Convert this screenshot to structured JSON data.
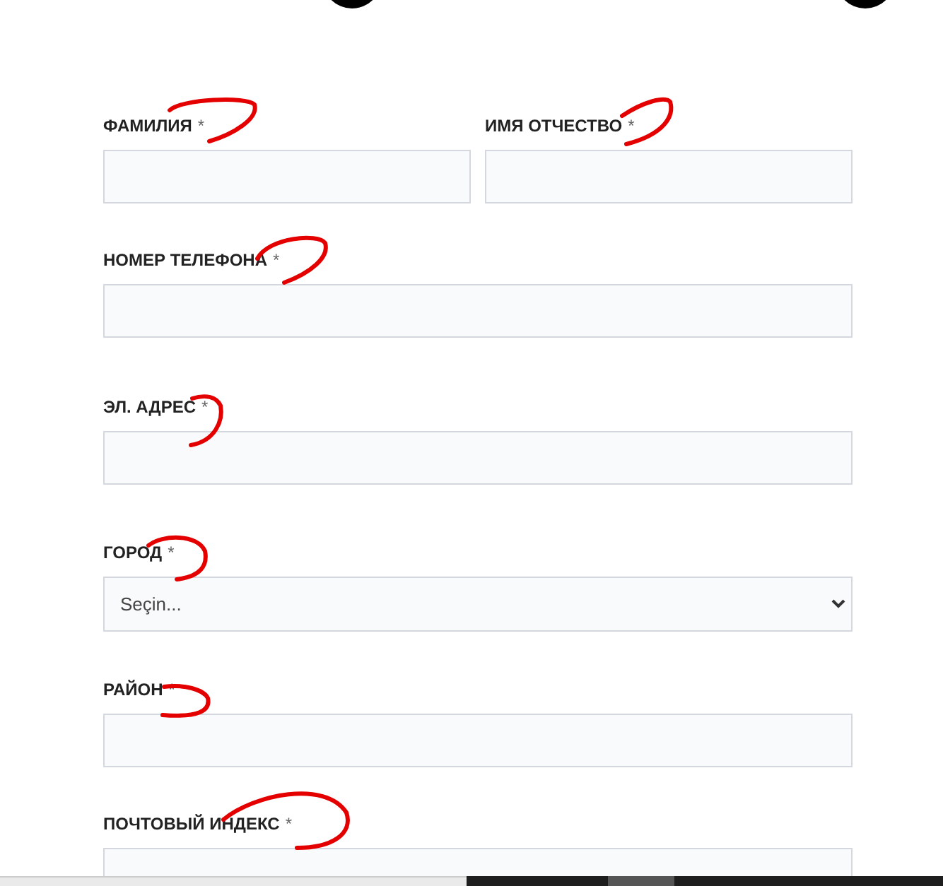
{
  "rows": [
    [
      {
        "label": "ФАМИЛИЯ",
        "required": true,
        "kind": "text"
      },
      {
        "label": "ИМЯ ОТЧЕСТВО",
        "required": true,
        "kind": "text"
      }
    ],
    [
      {
        "label": "НОМЕР ТЕЛЕФОНА",
        "required": true,
        "kind": "text"
      }
    ],
    [
      {
        "label": "ЭЛ. АДРЕС",
        "required": true,
        "kind": "text"
      }
    ],
    [
      {
        "label": "ГОРОД",
        "required": true,
        "kind": "select",
        "value": "Seçin..."
      }
    ],
    [
      {
        "label": "РАЙОН",
        "required": true,
        "kind": "text"
      }
    ],
    [
      {
        "label": "ПОЧТОВЫЙ ИНДЕКС",
        "required": true,
        "kind": "text"
      }
    ]
  ],
  "required_mark": "*"
}
